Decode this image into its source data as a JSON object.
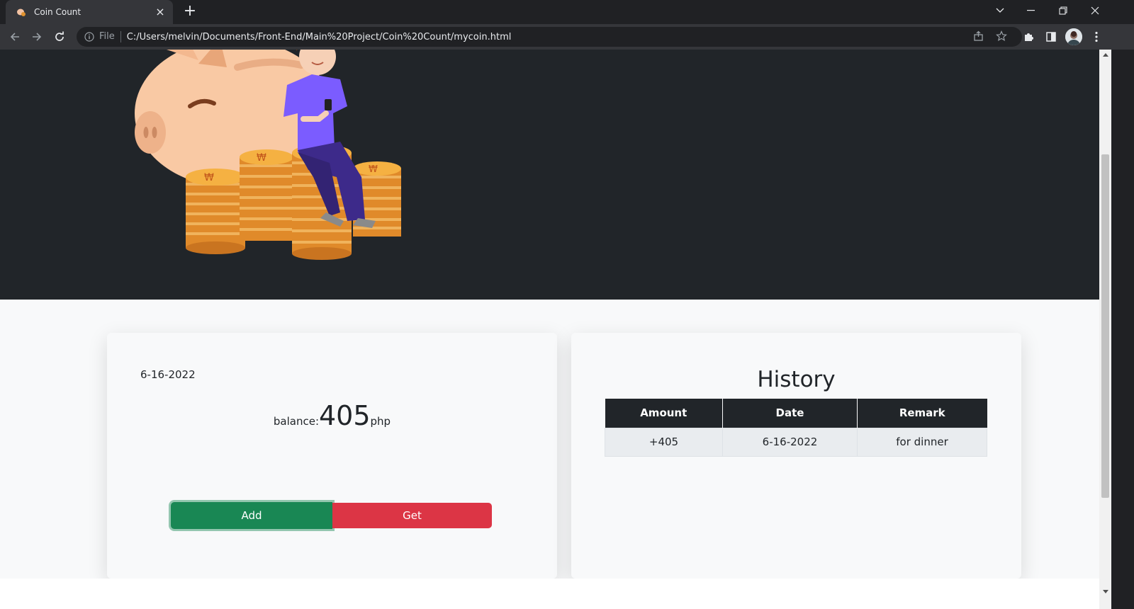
{
  "browser": {
    "tab_title": "Coin Count",
    "url_scheme_label": "File",
    "url": "C:/Users/melvin/Documents/Front-End/Main%20Project/Coin%20Count/mycoin.html"
  },
  "wallet": {
    "date": "6-16-2022",
    "balance_label": "balance:",
    "balance_amount": "405",
    "balance_unit": "php",
    "add_label": "Add",
    "get_label": "Get"
  },
  "history": {
    "title": "History",
    "columns": [
      "Amount",
      "Date",
      "Remark"
    ],
    "rows": [
      [
        "+405",
        "6-16-2022",
        "for dinner"
      ]
    ]
  },
  "colors": {
    "hero_bg": "#212529",
    "add_button": "#198754",
    "get_button": "#dc3545",
    "table_header": "#212529"
  },
  "icons": {
    "back": "arrow-left-icon",
    "forward": "arrow-right-icon",
    "reload": "reload-icon",
    "info": "info-icon",
    "share": "share-icon",
    "bookmark": "star-icon",
    "extensions": "puzzle-icon",
    "side_panel": "side-panel-icon",
    "menu": "kebab-menu-icon"
  }
}
